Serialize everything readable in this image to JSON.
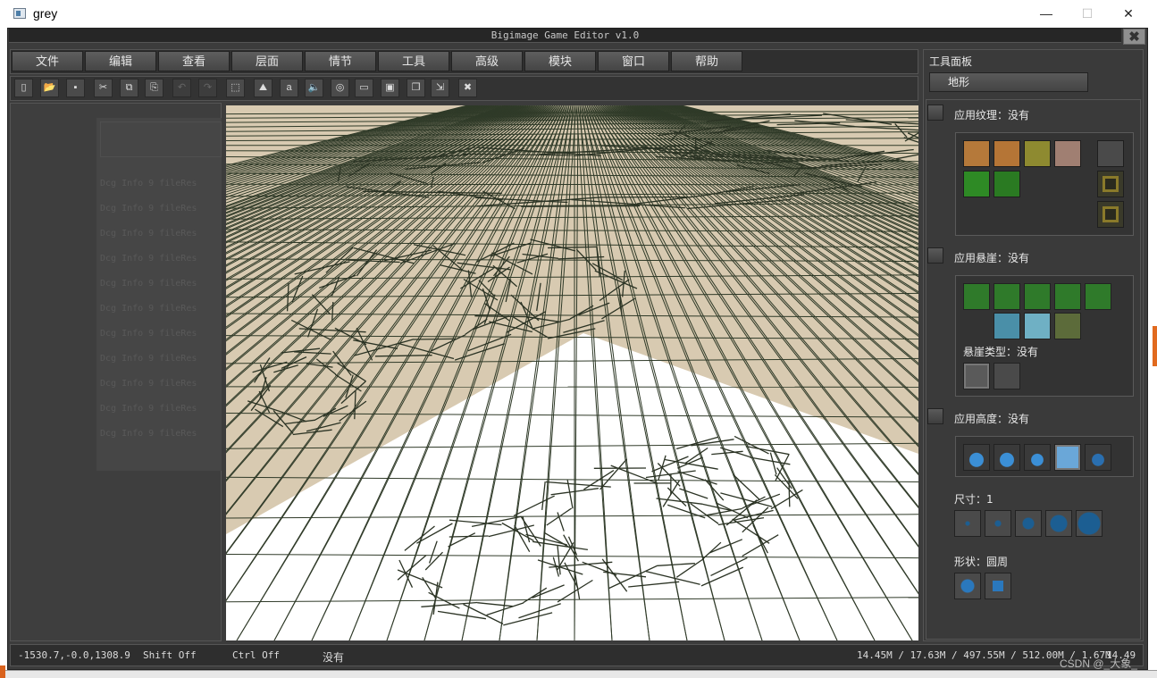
{
  "window": {
    "title": "grey",
    "minimize_glyph": "—",
    "maximize_glyph": "☐",
    "close_glyph": "✕"
  },
  "app": {
    "caption": "Bigimage Game Editor v1.0",
    "close_glyph": "✖"
  },
  "menu": [
    "文件",
    "编辑",
    "查看",
    "层面",
    "情节",
    "工具",
    "高级",
    "模块",
    "窗口",
    "帮助"
  ],
  "toolbar": [
    {
      "icon": "new-file-icon",
      "glyph": "▯",
      "state": "enabled"
    },
    {
      "icon": "open-folder-icon",
      "glyph": "📂",
      "state": "enabled"
    },
    {
      "icon": "save-icon",
      "glyph": "▪",
      "state": "enabled"
    },
    {
      "icon": "cut-icon",
      "glyph": "✂",
      "state": "enabled"
    },
    {
      "icon": "copy-icon",
      "glyph": "⧉",
      "state": "enabled"
    },
    {
      "icon": "paste-icon",
      "glyph": "⎘",
      "state": "enabled"
    },
    {
      "icon": "undo-icon",
      "glyph": "↶",
      "state": "disabled"
    },
    {
      "icon": "redo-icon",
      "glyph": "↷",
      "state": "disabled"
    },
    {
      "icon": "select-region-icon",
      "glyph": "⬚",
      "state": "enabled"
    },
    {
      "icon": "terrain-icon",
      "glyph": "⛰",
      "state": "enabled"
    },
    {
      "icon": "text-icon",
      "glyph": "a",
      "state": "enabled"
    },
    {
      "icon": "sound-icon",
      "glyph": "🔈",
      "state": "enabled"
    },
    {
      "icon": "fingerprint-icon",
      "glyph": "◎",
      "state": "enabled"
    },
    {
      "icon": "camera-icon",
      "glyph": "▭",
      "state": "enabled"
    },
    {
      "icon": "monitor-icon",
      "glyph": "▣",
      "state": "enabled"
    },
    {
      "icon": "object-icon",
      "glyph": "❒",
      "state": "enabled"
    },
    {
      "icon": "export-icon",
      "glyph": "⇲",
      "state": "enabled"
    },
    {
      "icon": "exit-icon",
      "glyph": "✖",
      "state": "enabled"
    }
  ],
  "log": {
    "line_prefix": "Dcg Info  9  fileRes",
    "line_count": 11
  },
  "panel": {
    "title": "工具面板",
    "tab": "地形",
    "texture": {
      "label": "应用纹理：没有",
      "swatches": [
        "#b5793a",
        "#b57536",
        "#8e8a30",
        "#a07f72",
        "#2e8a25",
        "#2a7a22"
      ]
    },
    "cliff": {
      "label": "应用悬崖：没有",
      "type_label": "悬崖类型：没有"
    },
    "height": {
      "label": "应用高度：没有"
    },
    "size": {
      "label": "尺寸：1"
    },
    "shape": {
      "label": "形状：圆周"
    }
  },
  "status": {
    "coords": "-1530.7,-0.0,1308.9",
    "shift": "Shift Off",
    "ctrl": "Ctrl Off",
    "mode": "没有",
    "memory": "14.45M / 17.63M / 497.55M / 512.00M / 1.67M",
    "fps": "14.49"
  },
  "overlay": {
    "watermark": "CSDN @_大象_"
  },
  "colors": {
    "mesh_line": "#2f3a28",
    "ground": "#d8cab1",
    "snow": "#ffffff",
    "accent": "#e16a1f"
  }
}
